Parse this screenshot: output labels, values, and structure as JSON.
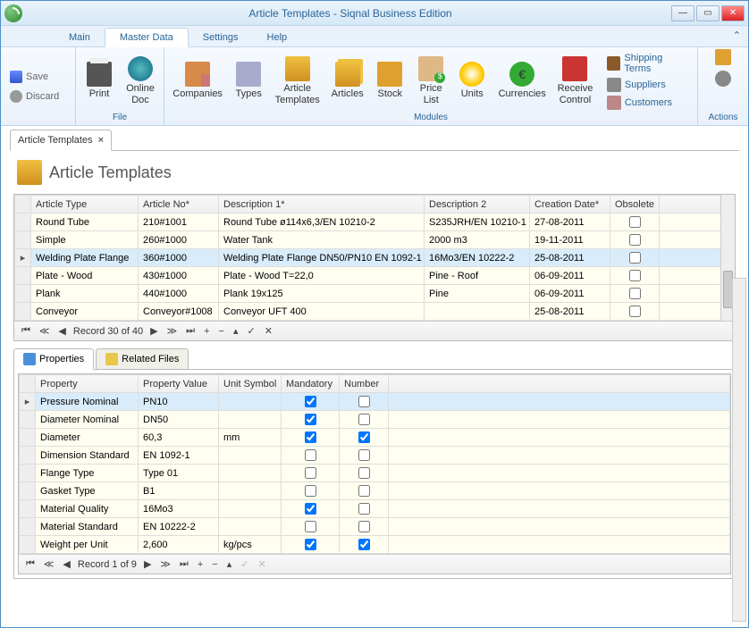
{
  "window": {
    "title": "Article Templates - Siqnal Business Edition"
  },
  "ribbon": {
    "tabs": [
      "Main",
      "Master Data",
      "Settings",
      "Help"
    ],
    "active_tab": 1,
    "file": {
      "save": "Save",
      "discard": "Discard",
      "print": "Print",
      "online_doc": "Online\nDoc",
      "label": "File"
    },
    "modules": {
      "items": [
        "Companies",
        "Types",
        "Article\nTemplates",
        "Articles",
        "Stock",
        "Price\nList",
        "Units",
        "Currencies",
        "Receive\nControl"
      ],
      "side_links": [
        "Shipping Terms",
        "Suppliers",
        "Customers"
      ],
      "label": "Modules"
    },
    "actions": {
      "label": "Actions"
    }
  },
  "doc_tab": {
    "label": "Article Templates"
  },
  "page_title": "Article Templates",
  "main_grid": {
    "columns": [
      "Article Type",
      "Article No*",
      "Description 1*",
      "Description 2",
      "Creation Date*",
      "Obsolete"
    ],
    "rows": [
      {
        "type": "Round Tube",
        "no": "210#1001",
        "d1": "Round Tube ø114x6,3/EN 10210-2",
        "d2": "S235JRH/EN 10210-1",
        "date": "27-08-2011",
        "obs": false,
        "sel": false
      },
      {
        "type": "Simple",
        "no": "260#1000",
        "d1": "Water Tank",
        "d2": "2000 m3",
        "date": "19-11-2011",
        "obs": false,
        "sel": false
      },
      {
        "type": "Welding Plate Flange",
        "no": "360#1000",
        "d1": "Welding Plate Flange DN50/PN10 EN 1092-1",
        "d2": "16Mo3/EN 10222-2",
        "date": "25-08-2011",
        "obs": false,
        "sel": true
      },
      {
        "type": "Plate - Wood",
        "no": "430#1000",
        "d1": "Plate - Wood T=22,0",
        "d2": "Pine - Roof",
        "date": "06-09-2011",
        "obs": false,
        "sel": false
      },
      {
        "type": "Plank",
        "no": "440#1000",
        "d1": "Plank 19x125",
        "d2": "Pine",
        "date": "06-09-2011",
        "obs": false,
        "sel": false
      },
      {
        "type": "Conveyor",
        "no": "Conveyor#1008",
        "d1": "Conveyor UFT 400",
        "d2": "",
        "date": "25-08-2011",
        "obs": false,
        "sel": false
      }
    ],
    "nav": "Record 30 of 40"
  },
  "detail_tabs": [
    "Properties",
    "Related Files"
  ],
  "detail_active": 0,
  "prop_grid": {
    "columns": [
      "Property",
      "Property Value",
      "Unit Symbol",
      "Mandatory",
      "Number"
    ],
    "rows": [
      {
        "p": "Pressure Nominal",
        "v": "PN10",
        "u": "",
        "m": true,
        "n": false,
        "sel": true
      },
      {
        "p": "Diameter Nominal",
        "v": "DN50",
        "u": "",
        "m": true,
        "n": false,
        "sel": false
      },
      {
        "p": "Diameter",
        "v": "60,3",
        "u": "mm",
        "m": true,
        "n": true,
        "sel": false
      },
      {
        "p": "Dimension Standard",
        "v": "EN 1092-1",
        "u": "",
        "m": false,
        "n": false,
        "sel": false
      },
      {
        "p": "Flange Type",
        "v": "Type 01",
        "u": "",
        "m": false,
        "n": false,
        "sel": false
      },
      {
        "p": "Gasket Type",
        "v": "B1",
        "u": "",
        "m": false,
        "n": false,
        "sel": false
      },
      {
        "p": "Material Quality",
        "v": "16Mo3",
        "u": "",
        "m": true,
        "n": false,
        "sel": false
      },
      {
        "p": "Material Standard",
        "v": "EN 10222-2",
        "u": "",
        "m": false,
        "n": false,
        "sel": false
      },
      {
        "p": "Weight per Unit",
        "v": "2,600",
        "u": "kg/pcs",
        "m": true,
        "n": true,
        "sel": false
      }
    ],
    "nav": "Record 1 of 9"
  }
}
